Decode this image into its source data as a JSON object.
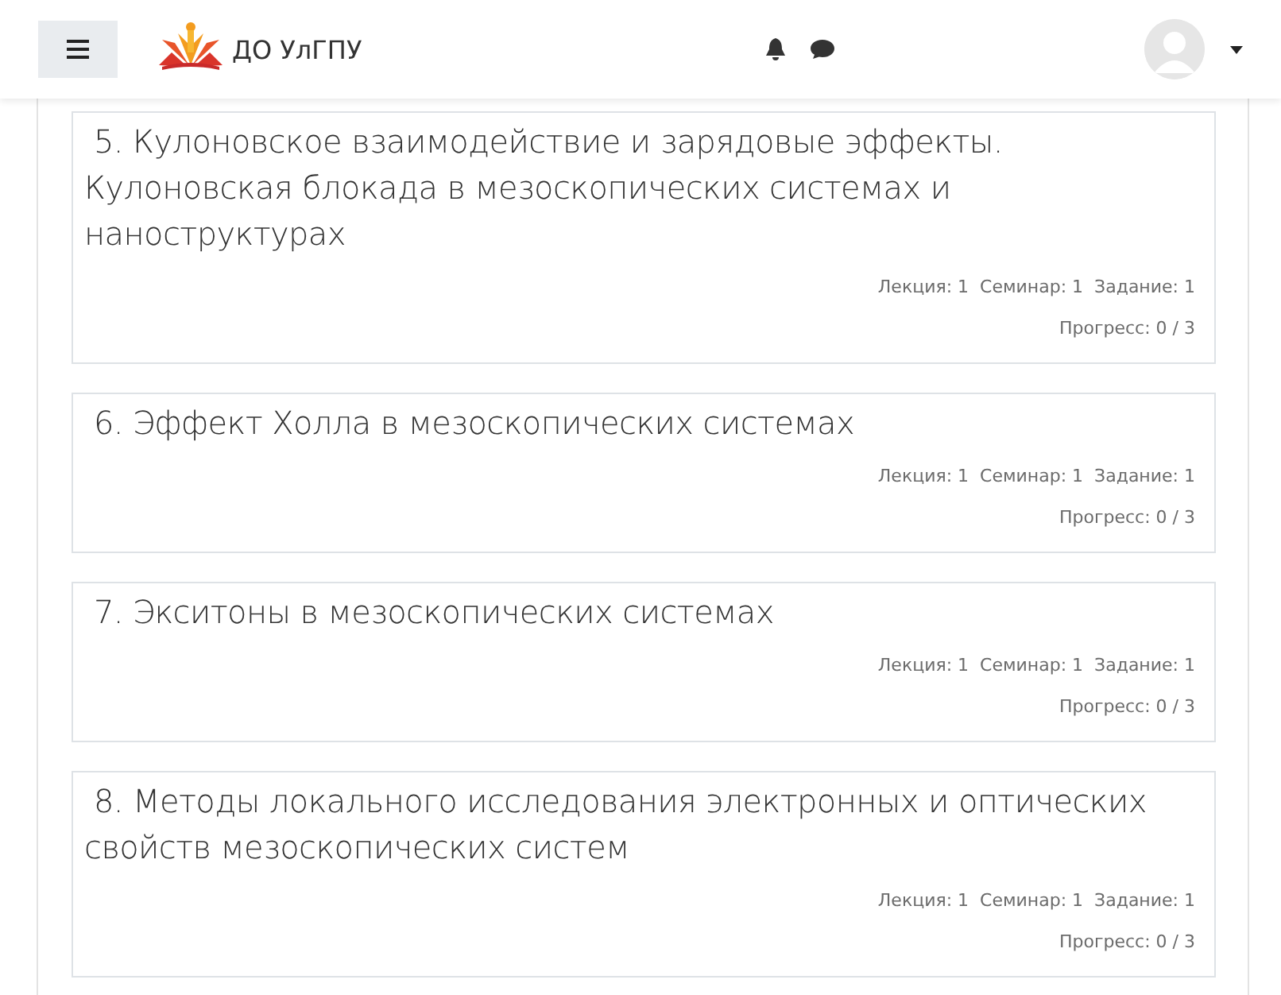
{
  "header": {
    "site_name": "ДО УлГПУ"
  },
  "sections": [
    {
      "title": "5. Кулоновское взаимодействие и зарядовые эффекты. Кулоновская блокада в мезоскопических системах и наноструктурах",
      "activities": "Лекция: 1  Семинар: 1  Задание: 1",
      "progress": "Прогресс: 0 / 3"
    },
    {
      "title": "6. Эффект Холла в мезоскопических системах",
      "activities": "Лекция: 1  Семинар: 1  Задание: 1",
      "progress": "Прогресс: 0 / 3"
    },
    {
      "title": "7. Экситоны в мезоскопических системах",
      "activities": "Лекция: 1  Семинар: 1  Задание: 1",
      "progress": "Прогресс: 0 / 3"
    },
    {
      "title": "8. Методы локального исследования электронных и оптических свойств мезоскопических систем",
      "activities": "Лекция: 1  Семинар: 1  Задание: 1",
      "progress": "Прогресс: 0 / 3"
    }
  ]
}
